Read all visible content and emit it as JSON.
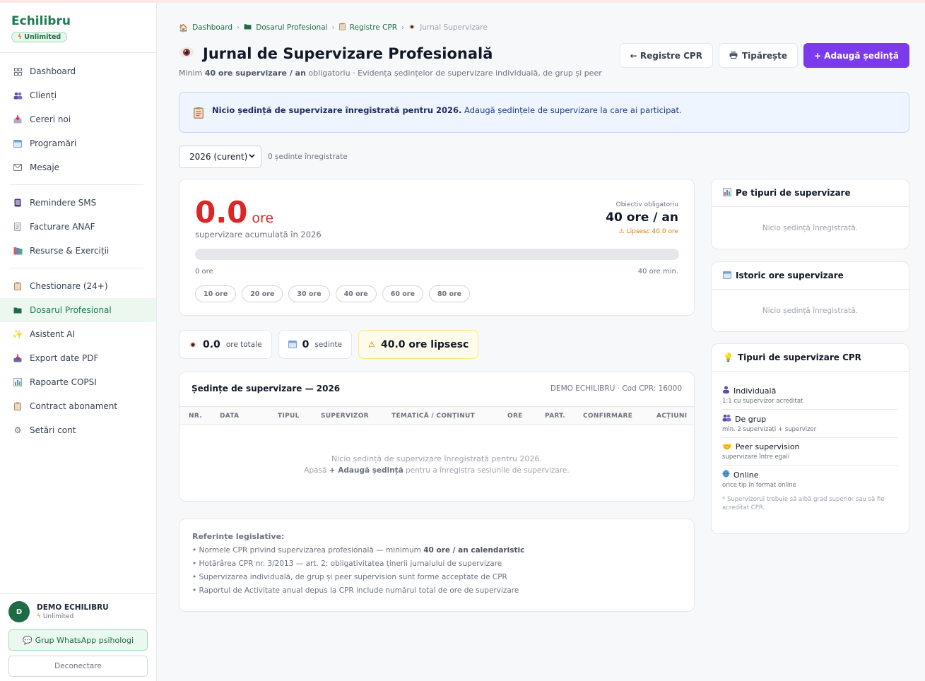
{
  "brand": {
    "name": "Echilibru",
    "plan": "Unlimited"
  },
  "sidebar": {
    "group1": [
      {
        "label": "Dashboard"
      },
      {
        "label": "Clienți"
      },
      {
        "label": "Cereri noi"
      },
      {
        "label": "Programări"
      },
      {
        "label": "Mesaje"
      }
    ],
    "group2": [
      {
        "label": "Remindere SMS"
      },
      {
        "label": "Facturare ANAF"
      },
      {
        "label": "Resurse & Exerciții"
      }
    ],
    "group3": [
      {
        "label": "Chestionare (24+)"
      },
      {
        "label": "Dosarul Profesional"
      },
      {
        "label": "Asistent AI"
      },
      {
        "label": "Export date PDF"
      },
      {
        "label": "Rapoarte COPSI"
      },
      {
        "label": "Contract abonament"
      },
      {
        "label": "Setări cont"
      }
    ],
    "user": {
      "initial": "D",
      "name": "DEMO ECHILIBRU",
      "plan": "Unlimited"
    },
    "whatsapp_label": "Grup WhatsApp psihologi",
    "logout_label": "Deconectare"
  },
  "breadcrumb": [
    "Dashboard",
    "Dosarul Profesional",
    "Registre CPR",
    "Jurnal Supervizare"
  ],
  "page": {
    "title": "Jurnal de Supervizare Profesională",
    "subtitle_pre": "Minim ",
    "subtitle_bold": "40 ore supervizare / an",
    "subtitle_post": " obligatoriu · Evidența ședințelor de supervizare individuală, de grup și peer"
  },
  "actions": {
    "back_label": "← Registre CPR",
    "print_label": "Tipărește",
    "add_label": "+ Adaugă ședință"
  },
  "alert": {
    "bold": "Nicio ședință de supervizare înregistrată pentru 2026.",
    "text": " Adaugă ședințele de supervizare la care ai participat."
  },
  "filter": {
    "year_selected": "2026 (curent)",
    "count_text": "0 ședinte înregistrate"
  },
  "hours": {
    "value": "0.0",
    "unit": "ore",
    "label": "supervizare acumulată în 2026",
    "goal_label": "Obiectiv obligatoriu",
    "goal_value": "40 ore / an",
    "missing": "⚠ Lipsesc 40.0 ore",
    "progress_fraction": 0,
    "bar_min": "0 ore",
    "bar_max": "40 ore min.",
    "milestones": [
      "10 ore",
      "20 ore",
      "30 ore",
      "40 ore",
      "60 ore",
      "80 ore"
    ]
  },
  "stats": {
    "total_value": "0.0",
    "total_label": "ore totale",
    "sessions_value": "0",
    "sessions_label": "ședinte",
    "missing_value": "40.0 ore lipsesc"
  },
  "sessions_table": {
    "title": "Ședințe de supervizare — 2026",
    "meta": "DEMO ECHILIBRU · Cod CPR: 16000",
    "columns": [
      "NR.",
      "DATA",
      "TIPUL",
      "SUPERVIZOR",
      "TEMATICĂ / CONȚINUT",
      "ORE",
      "PART.",
      "CONFIRMARE",
      "ACȚIUNI"
    ],
    "empty_line1": "Nicio ședință de supervizare înregistrată pentru 2026.",
    "empty_pre": "Apasă ",
    "empty_bold": "+ Adaugă ședință",
    "empty_post": " pentru a înregistra sesiunile de supervizare."
  },
  "references": {
    "title": "Referințe legislative:",
    "item1_pre": "• Normele CPR privind supervizarea profesională — minimum ",
    "item1_bold": "40 ore / an calendaristic",
    "item2": "• Hotărârea CPR nr. 3/2013 — art. 2: obligativitatea ținerii jurnalului de supervizare",
    "item3": "• Supervizarea individuală, de grup și peer supervision sunt forme acceptate de CPR",
    "item4": "• Raportul de Activitate anual depus la CPR include numărul total de ore de supervizare"
  },
  "side": {
    "by_type_title": "Pe tipuri de supervizare",
    "by_type_empty": "Nicio ședință înregistrată.",
    "history_title": "Istoric ore supervizare",
    "history_empty": "Nicio ședință înregistrată.",
    "types_title": "Tipuri de supervizare CPR",
    "types": [
      {
        "name": "Individuală",
        "desc": "1:1 cu supervizor acreditat"
      },
      {
        "name": "De grup",
        "desc": "min. 2 supervizați + supervizor"
      },
      {
        "name": "Peer supervision",
        "desc": "supervizare între egali"
      },
      {
        "name": "Online",
        "desc": "orice tip în format online"
      }
    ],
    "types_note": "* Supervizorul trebuie să aibă grad superior sau să fie acreditat CPR."
  },
  "colors": {
    "brand": "#1f7a52",
    "accent": "#7c3aed",
    "danger": "#dc2626",
    "warning": "#d97706"
  }
}
